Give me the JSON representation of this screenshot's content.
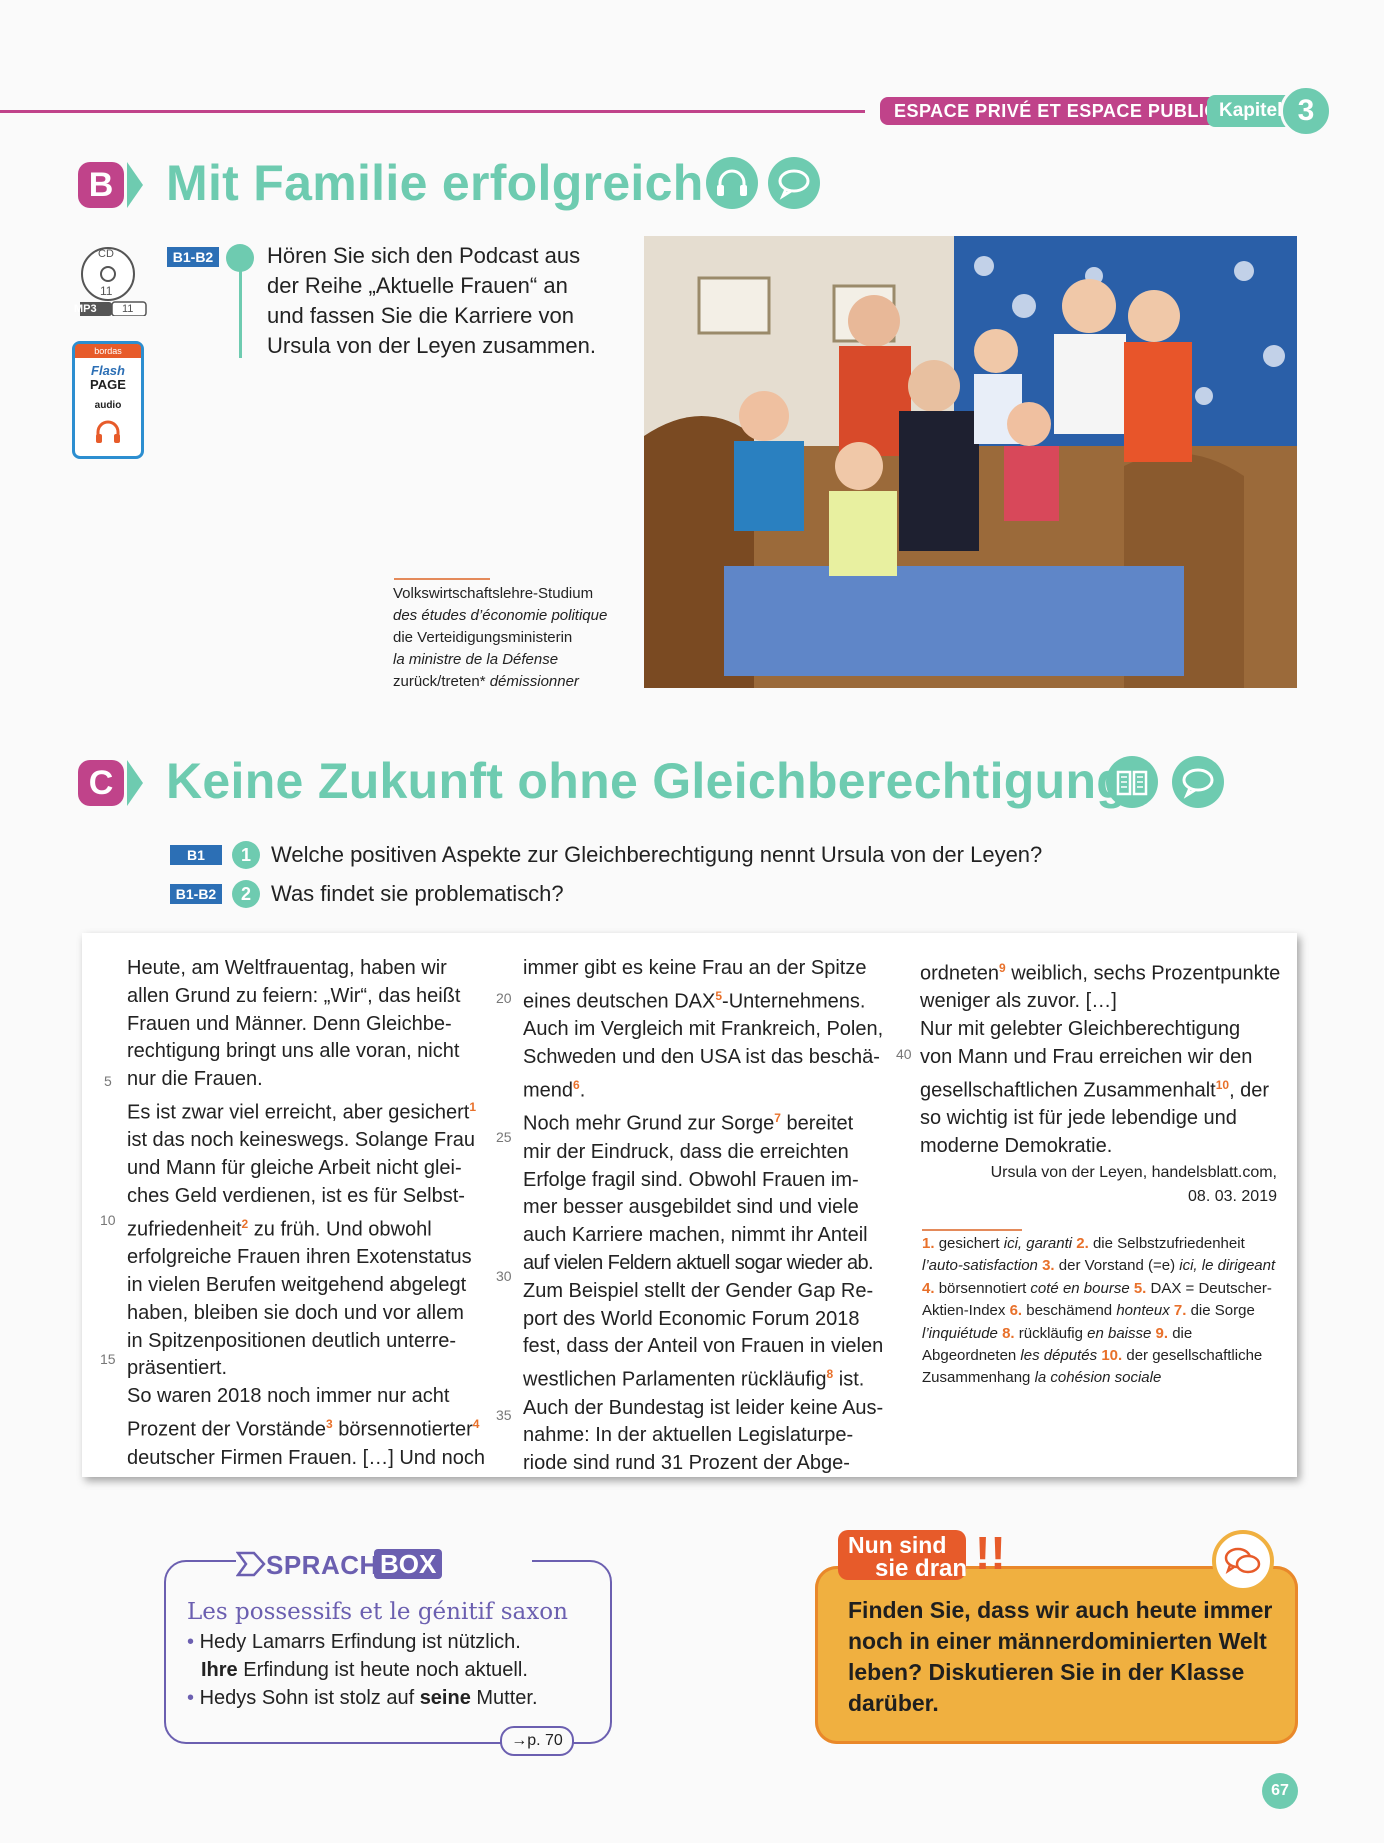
{
  "header": {
    "section_badge": "ESPACE PRIVÉ ET ESPACE PUBLIC",
    "kapitel_label": "Kapitel",
    "kapitel_number": "3"
  },
  "section_b": {
    "letter": "B",
    "title": "Mit Familie erfolgreich",
    "icons": [
      "headphones-icon",
      "speech-bubble-icon"
    ],
    "cd": {
      "cd_label": "CD",
      "cd_track": "11",
      "mp3_label": "MP3",
      "mp3_track": "11"
    },
    "flash_page": {
      "brand": "bordas",
      "line1": "Flash",
      "line2": "PAGE",
      "line3": "audio"
    },
    "task": {
      "level": "B1-B2",
      "lines": [
        "Hören Sie sich den Podcast aus",
        "der Reihe „Aktuelle Frauen“ an",
        "und fassen Sie die Karriere von",
        "Ursula von der Leyen zusammen."
      ]
    },
    "glossary": [
      {
        "de": "Volkswirtschaftslehre-Studium",
        "fr": "des études d’économie politique"
      },
      {
        "de": "die Verteidigungsministerin",
        "fr": "la ministre de la Défense"
      },
      {
        "de": "zurück/treten*",
        "fr": "démissionner"
      }
    ]
  },
  "section_c": {
    "letter": "C",
    "title": "Keine Zukunft ohne Gleichberechtigung",
    "icons": [
      "book-icon",
      "speech-bubble-icon"
    ],
    "questions": [
      {
        "level": "B1",
        "number": "1",
        "text": "Welche positiven Aspekte zur Gleichberechtigung nennt Ursula von der Leyen?"
      },
      {
        "level": "B1-B2",
        "number": "2",
        "text": "Was findet sie problematisch?"
      }
    ]
  },
  "article": {
    "col1": [
      "Heute, am Weltfrauentag, haben wir",
      "allen Grund zu feiern: „Wir“, das heißt",
      "Frauen und Männer. Denn Gleichbe-",
      "rechtigung bringt uns alle voran, nicht",
      "nur die Frauen.",
      "Es ist zwar viel erreicht, aber gesichert",
      "ist das noch keineswegs. Solange Frau",
      "und Mann für gleiche Arbeit nicht glei-",
      "ches Geld verdienen, ist es für Selbst-",
      "zufriedenheit",
      "erfolgreiche Frauen ihren Exotenstatus",
      "in vielen Berufen weitgehend abgelegt",
      "haben, bleiben sie doch und vor allem",
      "in Spitzenpositionen deutlich unterre-",
      "präsentiert.",
      "So waren 2018 noch immer nur acht",
      "Prozent der Vorstände",
      "deutscher Firmen Frauen. […] Und noch"
    ],
    "col1_frag": {
      "zufriedenheit_rest": " zu früh. Und obwohl",
      "vorstaende_mid": " börsennotierter"
    },
    "col2": [
      "immer gibt es keine Frau an der Spitze",
      "eines deutschen DAX",
      "Auch im Vergleich mit Frankreich, Polen,",
      "Schweden und den USA ist das beschä-",
      "mend",
      "Noch mehr Grund zur Sorge",
      "mir der Eindruck, dass die erreichten",
      "Erfolge fragil sind. Obwohl Frauen im-",
      "mer besser ausgebildet sind und viele",
      "auch Karriere machen, nimmt ihr Anteil",
      "auf vielen Feldern aktuell sogar wieder ab.",
      "Zum Beispiel stellt der Gender Gap Re-",
      "port des World Economic Forum 2018",
      "fest, dass der Anteil von Frauen in vielen",
      "westlichen Parlamenten rückläufig",
      "Auch der Bundestag ist leider keine Aus-",
      "nahme: In der aktuellen Legislaturpe-",
      "riode sind rund 31 Prozent der Abge-"
    ],
    "col2_frag": {
      "dax_rest": "-Unternehmens.",
      "mend_rest": ".",
      "sorge_rest": " bereitet",
      "ruecklaeufig_rest": " ist."
    },
    "col3": [
      "ordneten",
      "weniger als zuvor. […]",
      "Nur mit gelebter Gleichberechtigung",
      "von Mann und Frau erreichen wir den",
      "gesellschaftlichen Zusammenhalt",
      "so wichtig ist für jede lebendige und",
      "moderne Demokratie."
    ],
    "col3_frag": {
      "ordneten_rest": " weiblich, sechs Prozentpunkte",
      "zusammenhalt_rest": ", der"
    },
    "footnote_marks": [
      "1",
      "2",
      "3",
      "4",
      "5",
      "6",
      "7",
      "8",
      "9",
      "10"
    ],
    "line_numbers": [
      "5",
      "10",
      "15",
      "20",
      "25",
      "30",
      "35",
      "40"
    ],
    "source": [
      "Ursula von der Leyen, handelsblatt.com,",
      "08. 03. 2019"
    ],
    "footnotes": [
      {
        "n": "1.",
        "de": "gesichert",
        "fr": "ici, garanti"
      },
      {
        "n": "2.",
        "de": "die Selbstzufriedenheit",
        "fr": "l’auto-satisfaction"
      },
      {
        "n": "3.",
        "de": "der Vorstand (=e)",
        "fr": "ici, le dirigeant"
      },
      {
        "n": "4.",
        "de": "börsennotiert",
        "fr": "coté en bourse"
      },
      {
        "n": "5.",
        "de": "DAX = Deutscher-Aktien-Index",
        "fr": ""
      },
      {
        "n": "6.",
        "de": "beschämend",
        "fr": "honteux"
      },
      {
        "n": "7.",
        "de": "die Sorge",
        "fr": "l’inquiétude"
      },
      {
        "n": "8.",
        "de": "rückläufig",
        "fr": "en baisse"
      },
      {
        "n": "9.",
        "de": "die Abgeordneten",
        "fr": "les députés"
      },
      {
        "n": "10.",
        "de": "der gesellschaftliche Zusammenhang",
        "fr": "la cohésion sociale"
      }
    ]
  },
  "sprachbox": {
    "word": "SPRACH",
    "box": "BOX",
    "title": "Les possessifs et le génitif saxon",
    "line1": "Hedy Lamarrs Erfindung ist nützlich.",
    "line2_bold": "Ihre",
    "line2_rest": " Erfindung ist heute noch aktuell.",
    "line3_a": "Hedys Sohn ist stolz auf ",
    "line3_bold": "seine",
    "line3_b": " Mutter.",
    "page_ref": "→p. 70"
  },
  "nun_sind_sie_dran": {
    "label1": "Nun sind",
    "label2": "sie dran",
    "excl": "!!",
    "text": "Finden Sie, dass wir auch heute immer noch in einer männerdominierten Welt leben? Diskutieren Sie in der Klasse darüber."
  },
  "page_number": "67",
  "colors": {
    "teal": "#6ecbb0",
    "magenta": "#c0438a",
    "blue": "#2c6fb5",
    "purple": "#6b5fb0",
    "orange": "#e8702a",
    "yellow": "#f0b040"
  }
}
